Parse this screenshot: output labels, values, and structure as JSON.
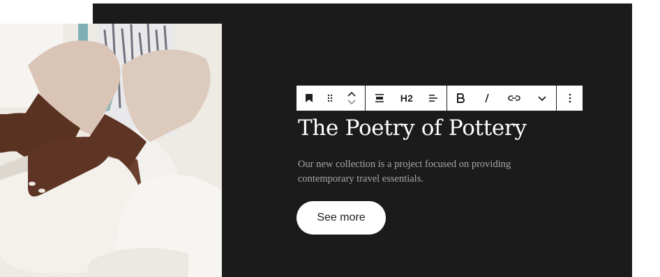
{
  "colors": {
    "panel_bg": "#1c1b1b",
    "heading_text": "#ffffff",
    "body_text": "#a9a6a2",
    "button_bg": "#ffffff",
    "toolbar_border": "#1e1e1e"
  },
  "toolbar": {
    "block_icon": "bookmark-icon",
    "drag_icon": "drag-handle-icon",
    "move_icons": [
      "chevron-up-icon",
      "chevron-down-icon"
    ],
    "align_icon": "align-icon",
    "heading_level_label": "H2",
    "text_align_icon": "text-align-icon",
    "bold_icon": "bold-icon",
    "italic_icon": "italic-icon",
    "link_icon": "link-icon",
    "more_formats_icon": "chevron-down-icon",
    "options_icon": "more-vertical-icon"
  },
  "content": {
    "heading": "The Poetry of Pottery",
    "description": "Our new collection is a project focused on providing contemporary travel essentials.",
    "button_label": "See more"
  }
}
